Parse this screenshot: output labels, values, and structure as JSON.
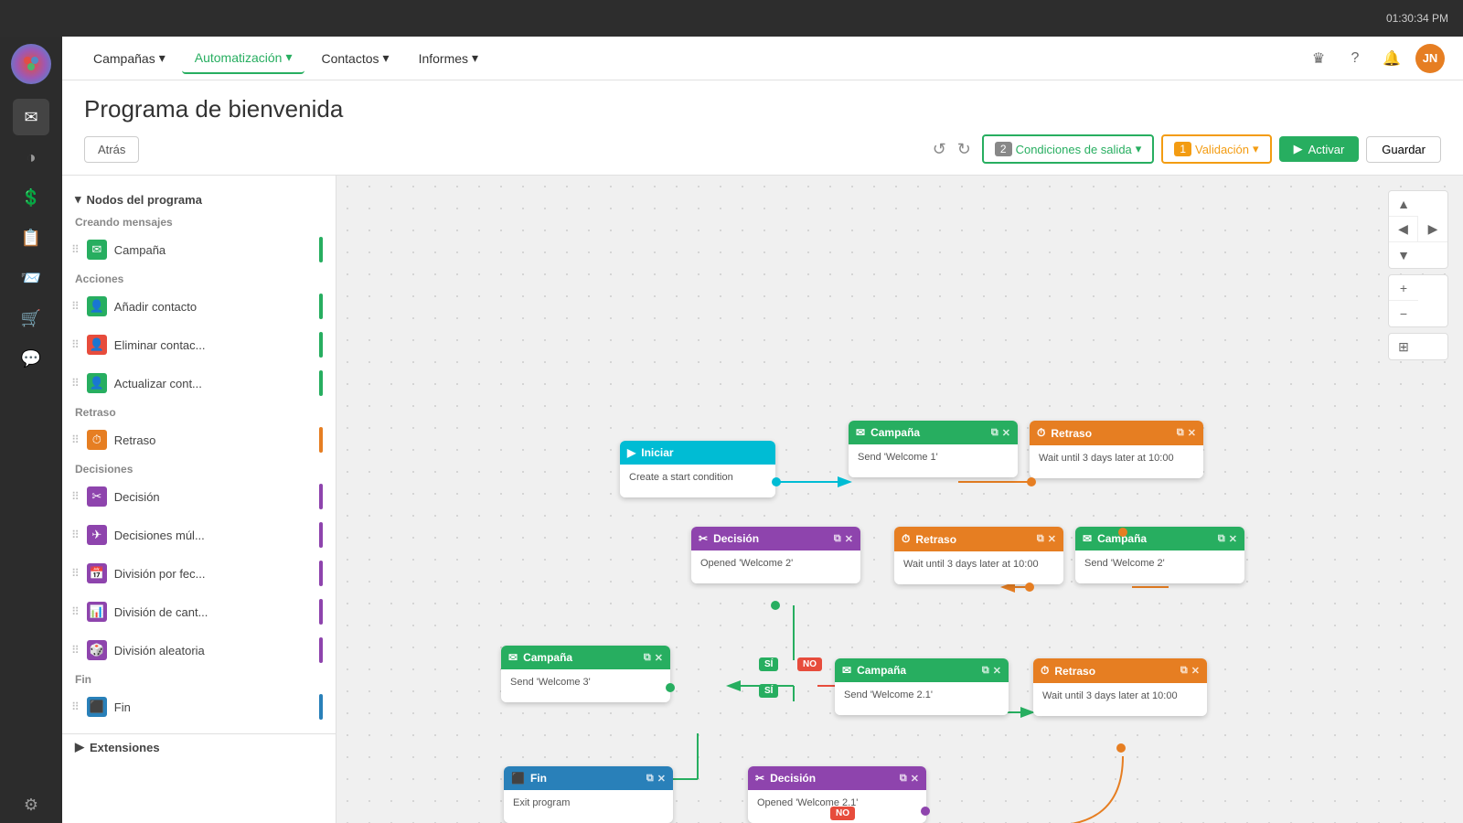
{
  "topbar": {
    "time": "01:30:34 PM"
  },
  "nav": {
    "items": [
      {
        "label": "Campañas",
        "active": false
      },
      {
        "label": "Automatización",
        "active": true
      },
      {
        "label": "Contactos",
        "active": false
      },
      {
        "label": "Informes",
        "active": false
      }
    ],
    "user_initials": "JN"
  },
  "page": {
    "title": "Programa de bienvenida",
    "back_label": "Atrás",
    "conditions_count": "2",
    "conditions_label": "Condiciones de salida",
    "validation_count": "1",
    "validation_label": "Validación",
    "activate_label": "Activar",
    "save_label": "Guardar"
  },
  "sidebar": {
    "section_nodes": "Nodos del programa",
    "section_collapsed": false,
    "section_messages": "Creando mensajes",
    "item_campaña": "Campaña",
    "section_acciones": "Acciones",
    "item_añadir": "Añadir contacto",
    "item_eliminar": "Eliminar contac...",
    "item_actualizar": "Actualizar cont...",
    "section_retraso": "Retraso",
    "item_retraso": "Retraso",
    "section_decisiones": "Decisiones",
    "item_decision": "Decisión",
    "item_decisiones_mult": "Decisiones múl...",
    "item_division_fec": "División por fec...",
    "item_division_cant": "División de cant...",
    "item_division_alea": "División aleatoria",
    "section_fin": "Fin",
    "item_fin": "Fin",
    "extensions_label": "Extensiones"
  },
  "nodes": {
    "iniciar": {
      "label": "Iniciar",
      "body": "Create a start condition"
    },
    "campaña1": {
      "label": "Campaña",
      "body": "Send 'Welcome 1'"
    },
    "retraso1": {
      "label": "Retraso",
      "body": "Wait until 3 days later at 10:00"
    },
    "decision1": {
      "label": "Decisión",
      "body": "Opened 'Welcome 2'"
    },
    "retraso2": {
      "label": "Retraso",
      "body": "Wait until 3 days later at 10:00"
    },
    "campaña2": {
      "label": "Campaña",
      "body": "Send 'Welcome 2'"
    },
    "campaña3": {
      "label": "Campaña",
      "body": "Send 'Welcome 3'"
    },
    "campaña4": {
      "label": "Campaña",
      "body": "Send 'Welcome 2.1'"
    },
    "retraso3": {
      "label": "Retraso",
      "body": "Wait until 3 days later at 10:00"
    },
    "fin": {
      "label": "Fin",
      "body": "Exit program"
    },
    "decision2": {
      "label": "Decisión",
      "body": "Opened 'Welcome 2.1'"
    }
  },
  "badges": {
    "yes": "SÍ",
    "no": "NO"
  }
}
